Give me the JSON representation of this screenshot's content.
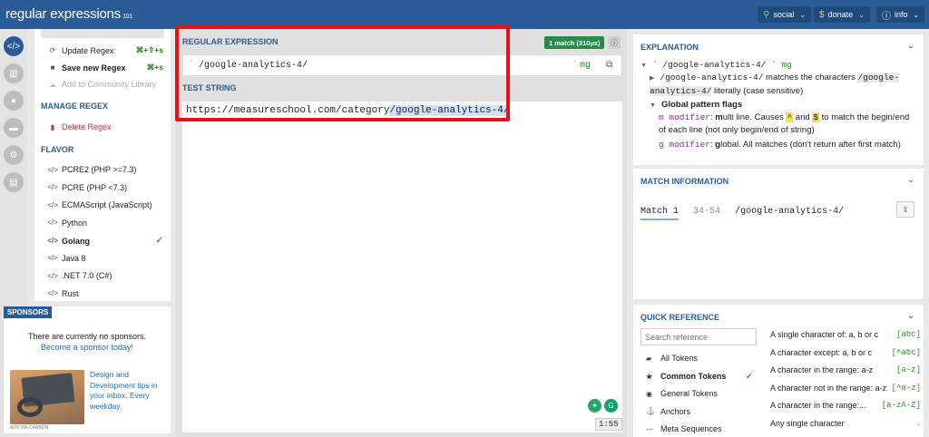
{
  "header": {
    "logo": "regular expressions",
    "logo_version": "101",
    "social": "social",
    "donate": "donate",
    "info": "info"
  },
  "left_panel": {
    "update_regex": "Update Regex",
    "update_kbd": "⌘+⇧+s",
    "save_new_regex": "Save new Regex",
    "save_kbd": "⌘+s",
    "add_library": "Add to Community Library",
    "manage_heading": "MANAGE REGEX",
    "delete_regex": "Delete Regex",
    "flavor_heading": "FLAVOR",
    "flavors": [
      "PCRE2 (PHP >=7.3)",
      "PCRE (PHP <7.3)",
      "ECMAScript (JavaScript)",
      "Python",
      "Golang",
      "Java 8",
      ".NET 7.0 (C#)",
      "Rust"
    ],
    "selected_flavor": "Golang"
  },
  "sponsors": {
    "tag": "SPONSORS",
    "line1": "There are currently no sponsors.",
    "line2": "Become a sponsor today!",
    "ad_text": "Design and Development tips in your inbox. Every weekday.",
    "ad_label": "ADS VIA CARBON"
  },
  "editor": {
    "regex_label": "REGULAR EXPRESSION",
    "match_badge": "1 match (310µs)",
    "delim": "`",
    "regex": "/google-analytics-4/",
    "flags": "mg",
    "test_label": "TEST STRING",
    "test_prefix": "https://measureschool.com/category",
    "test_match": "/google-analytics-4/",
    "timer": "1:55"
  },
  "explanation": {
    "title": "EXPLANATION",
    "root": "/google-analytics-4/",
    "root_flags": "mg",
    "node_token": "/google-analytics-4/",
    "node_mid": " matches the characters ",
    "node_literal": "/google-analytics-4/",
    "node_end": " literally (case sensitive)",
    "flags_heading": "Global pattern flags",
    "m_mod": "m modifier",
    "m_desc_a": ": ",
    "m_desc_b": "m",
    "m_desc_c": "ulti line. Causes ",
    "caret": "^",
    "and": " and ",
    "dollar": "$",
    "m_desc_d": " to match the begin/end",
    "m_desc_e": "of each line (not only begin/end of string)",
    "g_mod": "g modifier",
    "g_desc_a": ": ",
    "g_desc_b": "g",
    "g_desc_c": "lobal. All matches (don't return after first match)"
  },
  "match_info": {
    "title": "MATCH INFORMATION",
    "match_label": "Match 1",
    "range": "34-54",
    "value": "/google-analytics-4/"
  },
  "quick_ref": {
    "title": "QUICK REFERENCE",
    "search_placeholder": "Search reference",
    "items": [
      "All Tokens",
      "Common Tokens",
      "General Tokens",
      "Anchors",
      "Meta Sequences"
    ],
    "descs": [
      {
        "text": "A single character of: a, b or c",
        "tok": "[abc]"
      },
      {
        "text": "A character except: a, b or c",
        "tok": "[^abc]"
      },
      {
        "text": "A character in the range: a-z",
        "tok": "[a-z]"
      },
      {
        "text": "A character not in the range: a-z",
        "tok": "[^a-z]"
      },
      {
        "text": "A character in the range:...",
        "tok": "[a-zA-Z]"
      },
      {
        "text": "Any single character",
        "tok": "."
      }
    ]
  }
}
